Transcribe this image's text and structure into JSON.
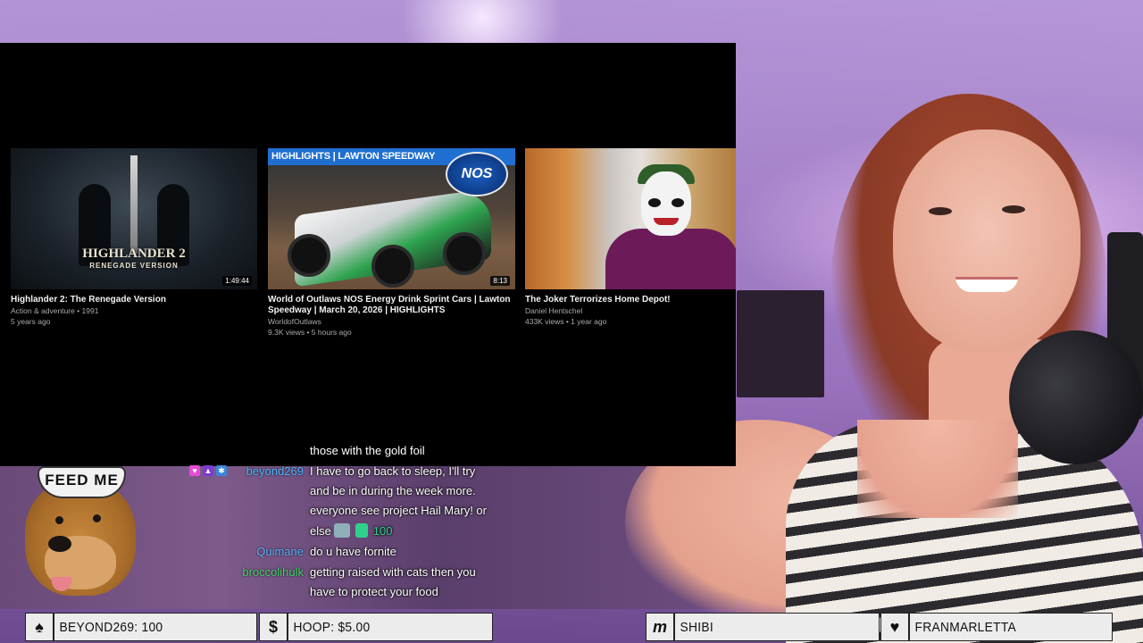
{
  "video_grid": {
    "cards": [
      {
        "title": "Highlander 2: The Renegade Version",
        "meta_line1": "Action & adventure • 1991",
        "meta_line2": "5 years ago",
        "duration": "1:49:44",
        "thumb_title": "HIGHLANDER 2",
        "thumb_subtitle": "RENEGADE VERSION"
      },
      {
        "title": "World of Outlaws NOS Energy Drink Sprint Cars | Lawton Speedway | March 20, 2026 | HIGHLIGHTS",
        "meta_line1": "WorldofOutlaws",
        "meta_line2": "9.3K views • 5 hours ago",
        "duration": "8:13",
        "thumb_banner": "HIGHLIGHTS | LAWTON SPEEDWAY",
        "thumb_logo": "NOS"
      },
      {
        "title": "The Joker Terrorizes Home Depot!",
        "meta_line1": "Daniel Hentschel",
        "meta_line2": "433K views • 1 year ago"
      }
    ]
  },
  "dog_hat": "FEED ME",
  "chat": {
    "messages": [
      {
        "user": "",
        "lines": [
          "those with the gold foil"
        ]
      },
      {
        "user": "beyond269",
        "user_color": "#4fb6ff",
        "lines": [
          "I have to go back to sleep, I'll try",
          "and be in during the week more.",
          "everyone see project Hail Mary! or",
          "else"
        ],
        "cheer": "100"
      },
      {
        "user": "Quimane",
        "user_color": "#5fb0ff",
        "lines": [
          "do u have fornite"
        ]
      },
      {
        "user": "broccolihulk",
        "user_color": "#45d26a",
        "lines": [
          "getting raised with cats then you",
          "have to protect your food"
        ]
      }
    ]
  },
  "bottom_bar": [
    {
      "icon": "spade-icon",
      "glyph": "♠",
      "text": "BEYOND269: 100"
    },
    {
      "icon": "dollar-icon",
      "glyph": "$",
      "text": "HOOP: $5.00"
    },
    {
      "icon": "m-logo-icon",
      "glyph": "m",
      "text": "SHIBI"
    },
    {
      "icon": "heart-icon",
      "glyph": "♥",
      "text": "FRANMARLETTA"
    }
  ],
  "colors": {
    "cheer": "#2fd18a",
    "highlight_banner": "#1f6fd1"
  }
}
